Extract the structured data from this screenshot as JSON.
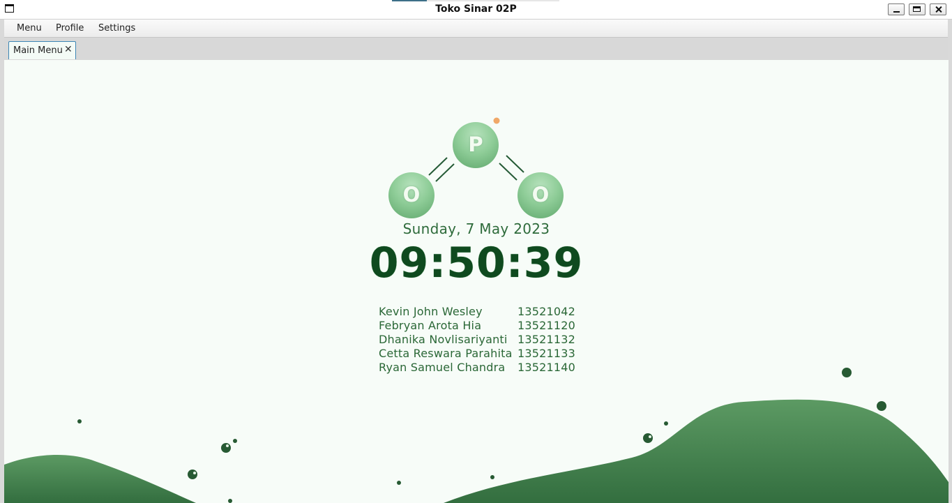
{
  "window": {
    "title": "Toko Sinar 02P"
  },
  "menubar": {
    "items": [
      "Menu",
      "Profile",
      "Settings"
    ]
  },
  "tabs": [
    {
      "label": "Main Menu",
      "close_glyph": "✕"
    }
  ],
  "logo": {
    "atoms": [
      "O",
      "P",
      "O"
    ]
  },
  "clock": {
    "date": "Sunday, 7 May 2023",
    "time": "09:50:39"
  },
  "members": [
    {
      "name": "Kevin John Wesley",
      "id": "13521042"
    },
    {
      "name": "Febryan Arota Hia",
      "id": "13521120"
    },
    {
      "name": "Dhanika Novlisariyanti",
      "id": "13521132"
    },
    {
      "name": "Cetta Reswara Parahita",
      "id": "13521133"
    },
    {
      "name": "Ryan Samuel Chandra",
      "id": "13521140"
    }
  ],
  "colors": {
    "accent_dark_green": "#0f4a1f",
    "wave_green": "#4b8a55",
    "background": "#f7fcf8",
    "dot_orange": "#f0a868"
  }
}
